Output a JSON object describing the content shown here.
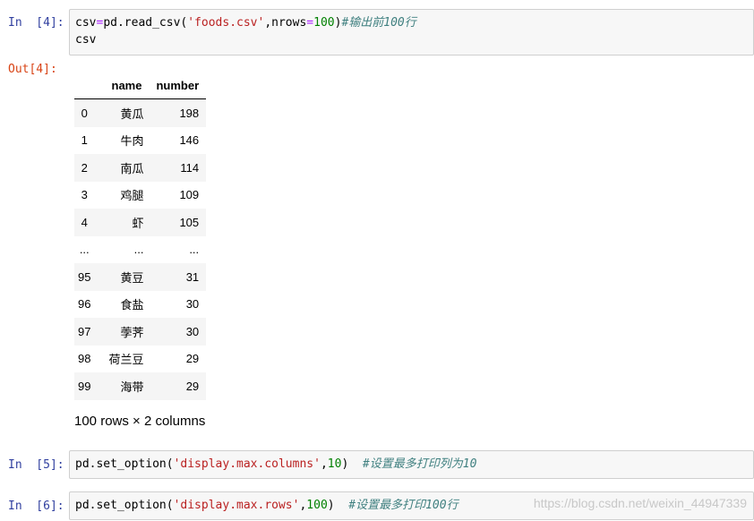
{
  "cell1": {
    "in_prompt": "In  [4]:",
    "code_var": "csv",
    "code_eq": "=",
    "code_call": "pd.read_csv(",
    "code_arg": "'foods.csv'",
    "code_kw": ",nrows",
    "code_eq2": "=",
    "code_num": "100",
    "code_close": ")",
    "code_comment": "#输出前100行",
    "line2": "csv",
    "out_prompt": "Out[4]:"
  },
  "dataframe": {
    "columns": [
      "name",
      "number"
    ],
    "rows": [
      {
        "index": "0",
        "name": "黄瓜",
        "number": "198"
      },
      {
        "index": "1",
        "name": "牛肉",
        "number": "146"
      },
      {
        "index": "2",
        "name": "南瓜",
        "number": "114"
      },
      {
        "index": "3",
        "name": "鸡腿",
        "number": "109"
      },
      {
        "index": "4",
        "name": "虾",
        "number": "105"
      },
      {
        "index": "...",
        "name": "...",
        "number": "..."
      },
      {
        "index": "95",
        "name": "黄豆",
        "number": "31"
      },
      {
        "index": "96",
        "name": "食盐",
        "number": "30"
      },
      {
        "index": "97",
        "name": "荸荠",
        "number": "30"
      },
      {
        "index": "98",
        "name": "荷兰豆",
        "number": "29"
      },
      {
        "index": "99",
        "name": "海带",
        "number": "29"
      }
    ],
    "shape_text": "100 rows × 2 columns"
  },
  "cell2": {
    "in_prompt": "In  [5]:",
    "code_call": "pd.set_option(",
    "code_arg": "'display.max.columns'",
    "code_sep": ",",
    "code_num": "10",
    "code_close": ")  ",
    "code_comment": "#设置最多打印列为10"
  },
  "cell3": {
    "in_prompt": "In  [6]:",
    "code_call": "pd.set_option(",
    "code_arg": "'display.max.rows'",
    "code_sep": ",",
    "code_num": "100",
    "code_close": ")  ",
    "code_comment": "#设置最多打印100行"
  },
  "watermark": "https://blog.csdn.net/weixin_44947339"
}
